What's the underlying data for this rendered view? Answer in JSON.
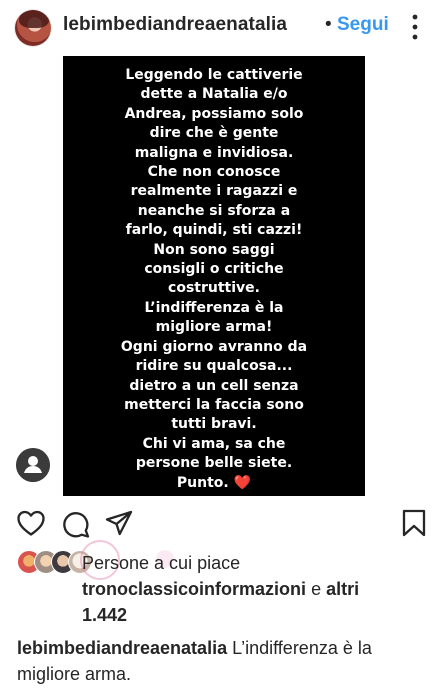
{
  "header": {
    "username": "lebimbediandreaenatalia",
    "separator": "•",
    "follow_label": "Segui",
    "more_icon": "more-vertical-icon"
  },
  "story": {
    "text": "Leggendo le cattiverie\ndette a Natalia e/o\nAndrea, possiamo solo\ndire che è gente\nmaligna e invidiosa.\nChe non conosce\nrealmente i ragazzi e\nneanche si sforza a\nfarlo, quindi, sti cazzi!\nNon sono saggi\nconsigli o critiche\ncostruttive.\nL’indifferenza è la\nmigliore arma!\nOgni giorno avranno da\nridire su qualcosa...\ndietro a un cell senza\nmetterci la faccia sono\ntutti bravi.\nChi vi ama, sa che\npersone belle siete.\nPunto.",
    "heart": "❤️",
    "background": "#000000"
  },
  "actions": {
    "like_icon": "heart-icon",
    "comment_icon": "comment-icon",
    "share_icon": "send-icon",
    "save_icon": "bookmark-icon"
  },
  "likes": {
    "prefix": "Persone a cui piace",
    "user": "tronoclassicoinformazioni",
    "connector": "e",
    "others": "altri",
    "others_count": "1.442"
  },
  "caption": {
    "username": "lebimbediandreaenatalia",
    "text": "L’indifferenza è la migliore arma."
  },
  "colors": {
    "link_blue": "#3897f0",
    "text": "#262626",
    "heart_red": "#e3262f"
  }
}
